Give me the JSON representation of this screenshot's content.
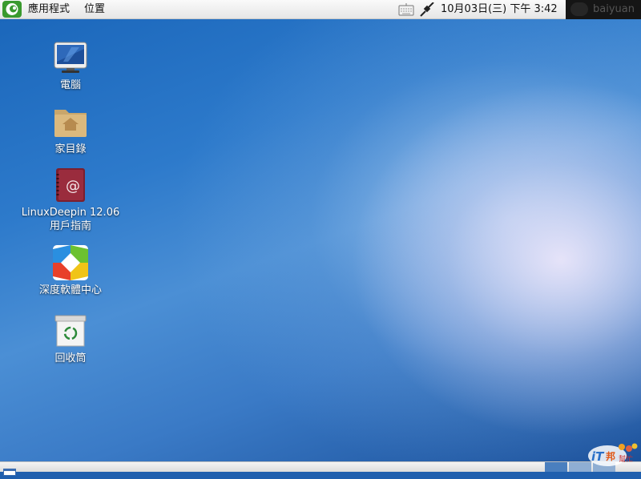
{
  "top_panel": {
    "menu": {
      "applications": "應用程式",
      "places": "位置"
    },
    "tray": {
      "keyboard_icon": "keyboard-icon",
      "network_icon": "network-cable-icon"
    },
    "clock": "10月03日(三) 下午  3:42",
    "user": {
      "name": "baiyuan"
    }
  },
  "desktop": {
    "icons": [
      {
        "label": "電腦",
        "icon": "computer-icon"
      },
      {
        "label": "家目錄",
        "icon": "home-folder-icon"
      },
      {
        "label": "LinuxDeepin 12.06",
        "label2": "用戶指南",
        "icon": "user-guide-book-icon"
      },
      {
        "label": "深度軟體中心",
        "icon": "software-center-icon"
      },
      {
        "label": "回收筒",
        "icon": "trash-icon"
      }
    ]
  },
  "bottom_panel": {
    "workspaces": [
      "1",
      "2",
      "3"
    ]
  },
  "watermark": {
    "text": "iT邦",
    "sub": "幫忙"
  },
  "colors": {
    "panel": "#ececec",
    "desktop_dark": "#1a4f99",
    "desktop_light": "#e8e6f8",
    "workspace_active": "#4a7fbf",
    "workspace_inactive": "#8faed3",
    "logo_green": "#3a9a2e"
  }
}
